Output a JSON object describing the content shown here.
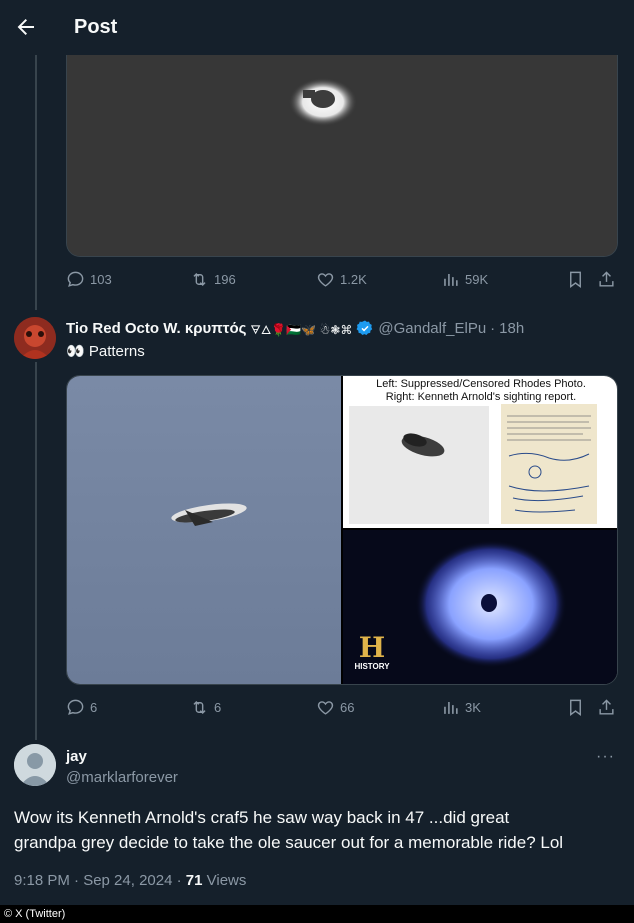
{
  "header": {
    "title": "Post"
  },
  "prev_post": {
    "actions": {
      "replies": "103",
      "reposts": "196",
      "likes": "1.2K",
      "views": "59K"
    }
  },
  "post": {
    "display_name": "Tio Red Octo W. κρυπτός",
    "name_emoji": "🜃🜂🌹🇵🇸🦋 ☃❃⌘",
    "handle": "@Gandalf_ElPu",
    "time": "18h",
    "text_emoji": "👀",
    "text": "Patterns",
    "image_caption_line1": "Left: Suppressed/Censored Rhodes Photo.",
    "image_caption_line2": "Right: Kenneth Arnold's sighting report.",
    "history_logo_text": "HISTORY",
    "actions": {
      "replies": "6",
      "reposts": "6",
      "likes": "66",
      "views": "3K"
    }
  },
  "reply": {
    "display_name": "jay",
    "handle": "@marklarforever",
    "text_line1": "Wow its Kenneth Arnold's craf5 he saw way back in 47 ...did great",
    "text_line2": "grandpa grey decide to take the ole saucer out for a memorable ride? Lol",
    "timestamp": "9:18 PM · Sep 24, 2024 ·",
    "view_count": "71",
    "views_label": "Views"
  },
  "footer": {
    "credit": "© X (Twitter)"
  },
  "colors": {
    "background": "#15202b",
    "muted": "#8b98a5",
    "verified": "#1d9bf0"
  }
}
